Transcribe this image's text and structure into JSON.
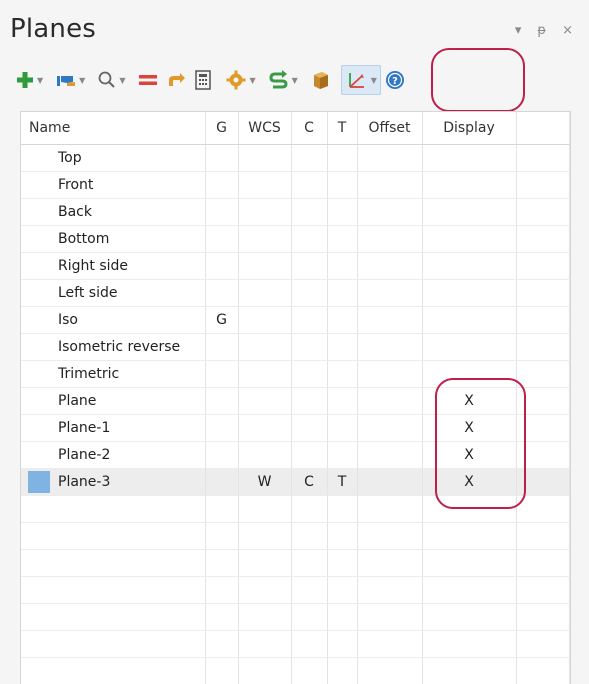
{
  "panel": {
    "title": "Planes",
    "controls": {
      "dropdown": "▾",
      "pin": "ᵽ",
      "close": "×"
    }
  },
  "toolbar": {
    "colors": {
      "add": "#2e9a3a",
      "red": "#d9453b",
      "orange": "#e19a2a",
      "blue": "#2f78c4",
      "green": "#3b9a45"
    },
    "items": [
      "add",
      "view",
      "find",
      "equal",
      "back",
      "calculator",
      "settings",
      "refresh",
      "cube",
      "axes",
      "help"
    ]
  },
  "table": {
    "columns": [
      "Name",
      "G",
      "WCS",
      "C",
      "T",
      "Offset",
      "Display",
      ""
    ],
    "rows": [
      {
        "name": "Top",
        "g": "",
        "wcs": "",
        "c": "",
        "t": "",
        "offset": "",
        "display": ""
      },
      {
        "name": "Front",
        "g": "",
        "wcs": "",
        "c": "",
        "t": "",
        "offset": "",
        "display": ""
      },
      {
        "name": "Back",
        "g": "",
        "wcs": "",
        "c": "",
        "t": "",
        "offset": "",
        "display": ""
      },
      {
        "name": "Bottom",
        "g": "",
        "wcs": "",
        "c": "",
        "t": "",
        "offset": "",
        "display": ""
      },
      {
        "name": "Right side",
        "g": "",
        "wcs": "",
        "c": "",
        "t": "",
        "offset": "",
        "display": ""
      },
      {
        "name": "Left side",
        "g": "",
        "wcs": "",
        "c": "",
        "t": "",
        "offset": "",
        "display": ""
      },
      {
        "name": "Iso",
        "g": "G",
        "wcs": "",
        "c": "",
        "t": "",
        "offset": "",
        "display": ""
      },
      {
        "name": "Isometric reverse",
        "g": "",
        "wcs": "",
        "c": "",
        "t": "",
        "offset": "",
        "display": ""
      },
      {
        "name": "Trimetric",
        "g": "",
        "wcs": "",
        "c": "",
        "t": "",
        "offset": "",
        "display": ""
      },
      {
        "name": "Plane",
        "g": "",
        "wcs": "",
        "c": "",
        "t": "",
        "offset": "",
        "display": "X"
      },
      {
        "name": "Plane-1",
        "g": "",
        "wcs": "",
        "c": "",
        "t": "",
        "offset": "",
        "display": "X"
      },
      {
        "name": "Plane-2",
        "g": "",
        "wcs": "",
        "c": "",
        "t": "",
        "offset": "",
        "display": "X"
      },
      {
        "name": "Plane-3",
        "g": "",
        "wcs": "W",
        "c": "C",
        "t": "T",
        "offset": "",
        "display": "X",
        "selected": true
      }
    ]
  }
}
